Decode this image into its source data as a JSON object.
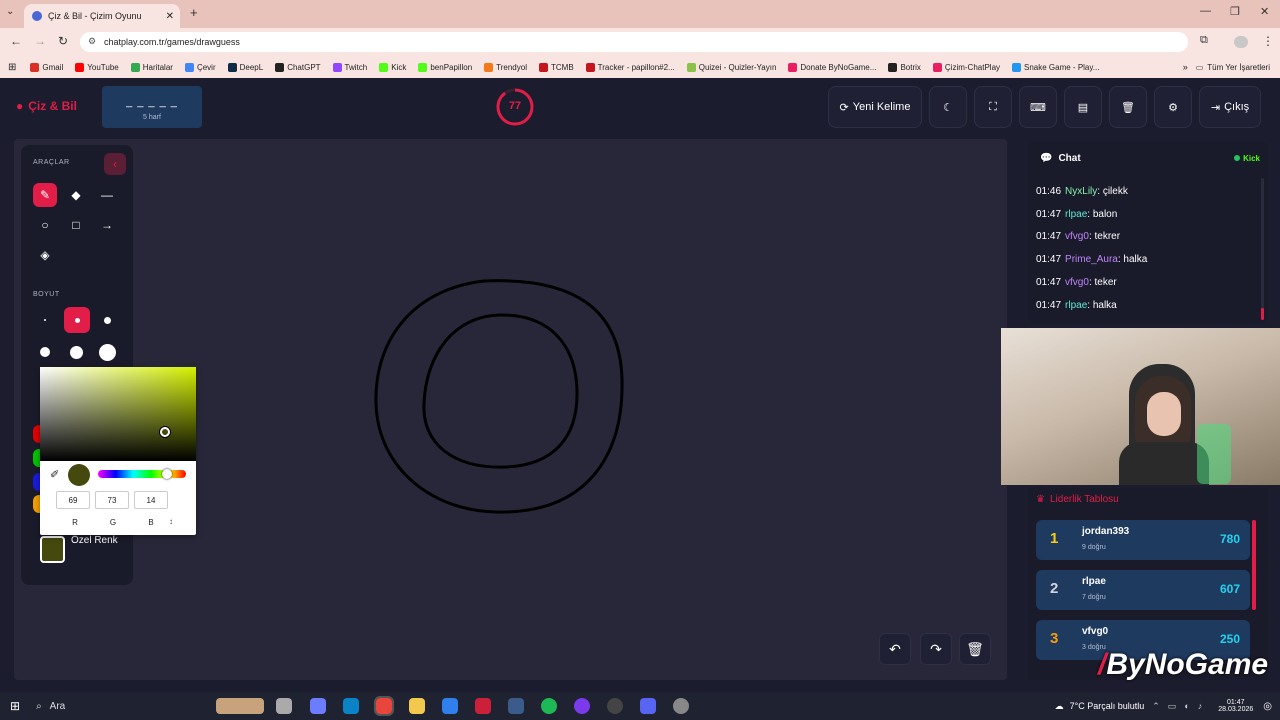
{
  "browser": {
    "tab_title": "Çiz & Bil - Çizim Oyunu",
    "url": "chatplay.com.tr/games/drawguess",
    "bookmarks": [
      {
        "label": "Gmail",
        "color": "#d93025"
      },
      {
        "label": "YouTube",
        "color": "#ff0000"
      },
      {
        "label": "Haritalar",
        "color": "#34a853"
      },
      {
        "label": "Çevir",
        "color": "#4285f4"
      },
      {
        "label": "DeepL",
        "color": "#0f2b46"
      },
      {
        "label": "ChatGPT",
        "color": "#222222"
      },
      {
        "label": "Twitch",
        "color": "#9146ff"
      },
      {
        "label": "Kick",
        "color": "#53fc18"
      },
      {
        "label": "benPapillon",
        "color": "#53fc18"
      },
      {
        "label": "Trendyol",
        "color": "#f27a1a"
      },
      {
        "label": "TCMB",
        "color": "#c4161c"
      },
      {
        "label": "Tracker - papillon#2...",
        "color": "#c4161c"
      },
      {
        "label": "Quizei - Quizler-Yayın",
        "color": "#8bc34a"
      },
      {
        "label": "Donate ByNoGame...",
        "color": "#e91e63"
      },
      {
        "label": "Botrix",
        "color": "#222222"
      },
      {
        "label": "Çizim-ChatPlay",
        "color": "#e91e63"
      },
      {
        "label": "Snake Game - Play...",
        "color": "#2196f3"
      }
    ],
    "all_bookmarks": "Tüm Yer İşaretleri"
  },
  "app": {
    "logo": "Çiz & Bil",
    "word_hint": "_ _ _ _ _",
    "word_length": "5 harf",
    "timer": "77",
    "timer_progress": 0.9,
    "new_word": "Yeni Kelime",
    "exit": "Çıkış",
    "accent": "#e11d48"
  },
  "tools": {
    "section_tools": "ARAÇLAR",
    "section_size": "BOYUT",
    "custom_color_label": "Özel Renk",
    "custom_color": "#45490e"
  },
  "picker": {
    "r": "69",
    "g": "73",
    "b": "14",
    "r_label": "R",
    "g_label": "G",
    "b_label": "B"
  },
  "chat": {
    "title": "Chat",
    "source": "Kick",
    "messages": [
      {
        "time": "01:46",
        "user": "NyxLily",
        "color": "#86efac",
        "text": ": çilekk"
      },
      {
        "time": "01:47",
        "user": "rlpae",
        "color": "#5eead4",
        "text": ": balon"
      },
      {
        "time": "01:47",
        "user": "vfvg0",
        "color": "#c084fc",
        "text": ": tekrer"
      },
      {
        "time": "01:47",
        "user": "Prime_Aura",
        "color": "#c084fc",
        "text": ": halka"
      },
      {
        "time": "01:47",
        "user": "vfvg0",
        "color": "#c084fc",
        "text": ": teker"
      },
      {
        "time": "01:47",
        "user": "rlpae",
        "color": "#5eead4",
        "text": ": halka"
      }
    ]
  },
  "leaderboard": {
    "title": "Liderlik Tablosu",
    "rows": [
      {
        "rank": "1",
        "name": "jordan393",
        "sub": "9 doğru",
        "points": "780",
        "rank_color": "#facc15"
      },
      {
        "rank": "2",
        "name": "rlpae",
        "sub": "7 doğru",
        "points": "607",
        "rank_color": "#d1d5db"
      },
      {
        "rank": "3",
        "name": "vfvg0",
        "sub": "3 doğru",
        "points": "250",
        "rank_color": "#f59e0b"
      }
    ]
  },
  "watermark": "ByNoGame",
  "taskbar": {
    "search": "Ara",
    "weather": "7°C  Parçalı bulutlu",
    "time": "01:47",
    "date": "28.03.2026"
  }
}
